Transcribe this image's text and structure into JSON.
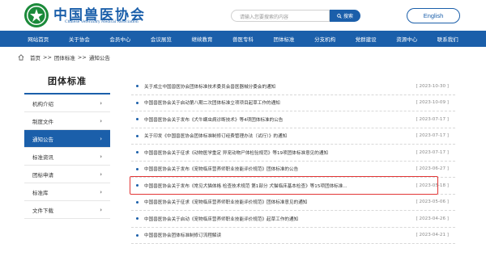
{
  "brand": {
    "name_cn": "中国兽医协会",
    "name_en": "Chinese Veterinary Medical Association"
  },
  "search": {
    "placeholder": "请输入您要搜索的内容",
    "button_label": "搜索"
  },
  "lang_button": "English",
  "nav": [
    "网站首页",
    "关于协会",
    "会员中心",
    "会议展览",
    "继续教育",
    "兽医专科",
    "团体标准",
    "分支机构",
    "党群建设",
    "资源中心",
    "联系我们"
  ],
  "breadcrumb": {
    "home": "首页",
    "sep": ">>",
    "level1": "团体标准",
    "level2": "通知公告"
  },
  "sidebar": {
    "title": "团体标准",
    "items": [
      {
        "label": "机构介绍"
      },
      {
        "label": "制度文件"
      },
      {
        "label": "通知公告"
      },
      {
        "label": "标准资讯"
      },
      {
        "label": "团标申请"
      },
      {
        "label": "标准库"
      },
      {
        "label": "文件下载"
      }
    ],
    "active_index": 2
  },
  "notices": [
    {
      "title": "关于成立中国兽医协会团体标准技术委员会兽医器械分委会的通知",
      "date": "[ 2023-10-30 ]"
    },
    {
      "title": "中国兽医协会关于启动第八期二次团体标准立项项目起草工作的通知",
      "date": "[ 2023-10-09 ]"
    },
    {
      "title": "中国兽医协会关于发布《犬牛螨虫病诊断技术》等4项团体标准的公告",
      "date": "[ 2023-07-17 ]"
    },
    {
      "title": "关于印发《中国兽医协会团体标准制修订经费管理办法（试行）》的通知",
      "date": "[ 2023-07-17 ]"
    },
    {
      "title": "中国兽医协会关于征求《动物医学重定 异宠动物尸体检验规范》等19项团体标准意见的通知",
      "date": "[ 2023-07-17 ]"
    },
    {
      "title": "中国兽医协会关于发布《宠物临床营养师职业技能评价规范》团体标准的公告",
      "date": "[ 2023-06-27 ]"
    },
    {
      "title": "中国兽医协会关于发布《常见犬猫体格 检查技术规范 第1部分 犬猫临床基本检查》等15项团体标准...",
      "date": "[ 2023-05-18 ]"
    },
    {
      "title": "中国兽医协会关于征求《宠物临床营养师职业技能评价规范》团体标准意见的通知",
      "date": "[ 2023-05-06 ]"
    },
    {
      "title": "中国兽医协会关于启动《宠物临床营养师职业技能评价规范》起草工作的通知",
      "date": "[ 2023-04-26 ]"
    },
    {
      "title": "中国兽医协会团体标准制修订流程解读",
      "date": "[ 2023-04-21 ]"
    }
  ],
  "highlighted_index": 5,
  "colors": {
    "primary": "#1b5faa",
    "highlight_border": "#e23636"
  }
}
